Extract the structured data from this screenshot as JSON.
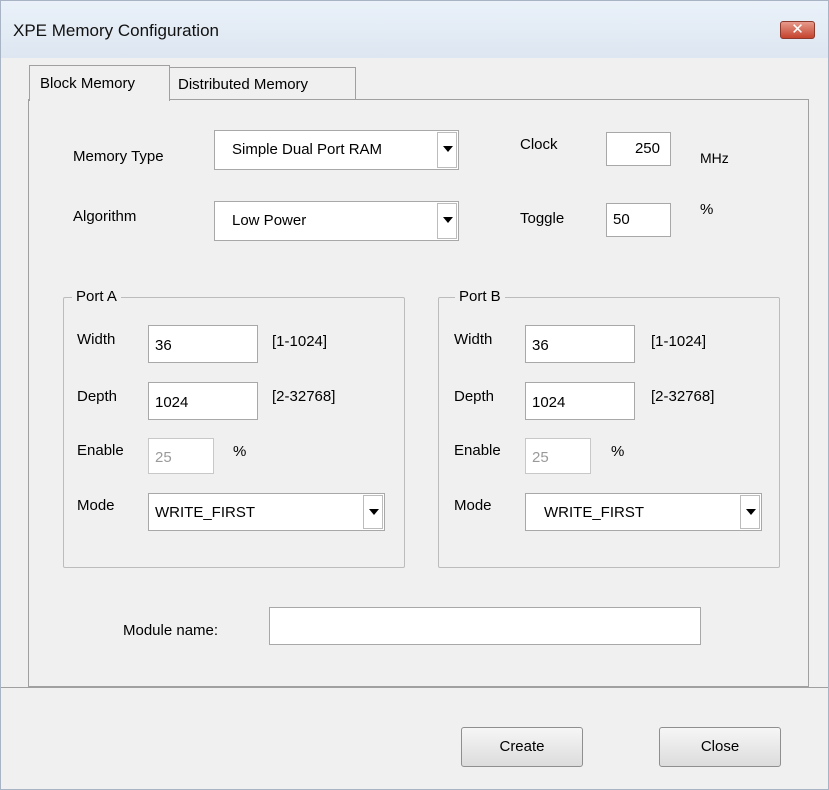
{
  "window": {
    "title": "XPE Memory Configuration",
    "close_glyph": "✕"
  },
  "tabs": [
    "Block Memory",
    "Distributed Memory"
  ],
  "memory_type": {
    "label": "Memory Type",
    "value": "Simple Dual Port RAM"
  },
  "algorithm": {
    "label": "Algorithm",
    "value": "Low Power"
  },
  "clock": {
    "label": "Clock",
    "value": "250",
    "unit": "MHz"
  },
  "toggle": {
    "label": "Toggle",
    "value": "50",
    "unit": "%"
  },
  "port_a": {
    "title": "Port A",
    "width_label": "Width",
    "width_value": "36",
    "width_range": "[1-1024]",
    "depth_label": "Depth",
    "depth_value": "1024",
    "depth_range": "[2-32768]",
    "enable_label": "Enable",
    "enable_value": "25",
    "enable_unit": "%",
    "mode_label": "Mode",
    "mode_value": "WRITE_FIRST"
  },
  "port_b": {
    "title": "Port B",
    "width_label": "Width",
    "width_value": "36",
    "width_range": "[1-1024]",
    "depth_label": "Depth",
    "depth_value": "1024",
    "depth_range": "[2-32768]",
    "enable_label": "Enable",
    "enable_value": "25",
    "enable_unit": "%",
    "mode_label": "Mode",
    "mode_value": "WRITE_FIRST"
  },
  "module": {
    "label": "Module name:",
    "value": ""
  },
  "buttons": {
    "create": "Create",
    "close": "Close"
  }
}
